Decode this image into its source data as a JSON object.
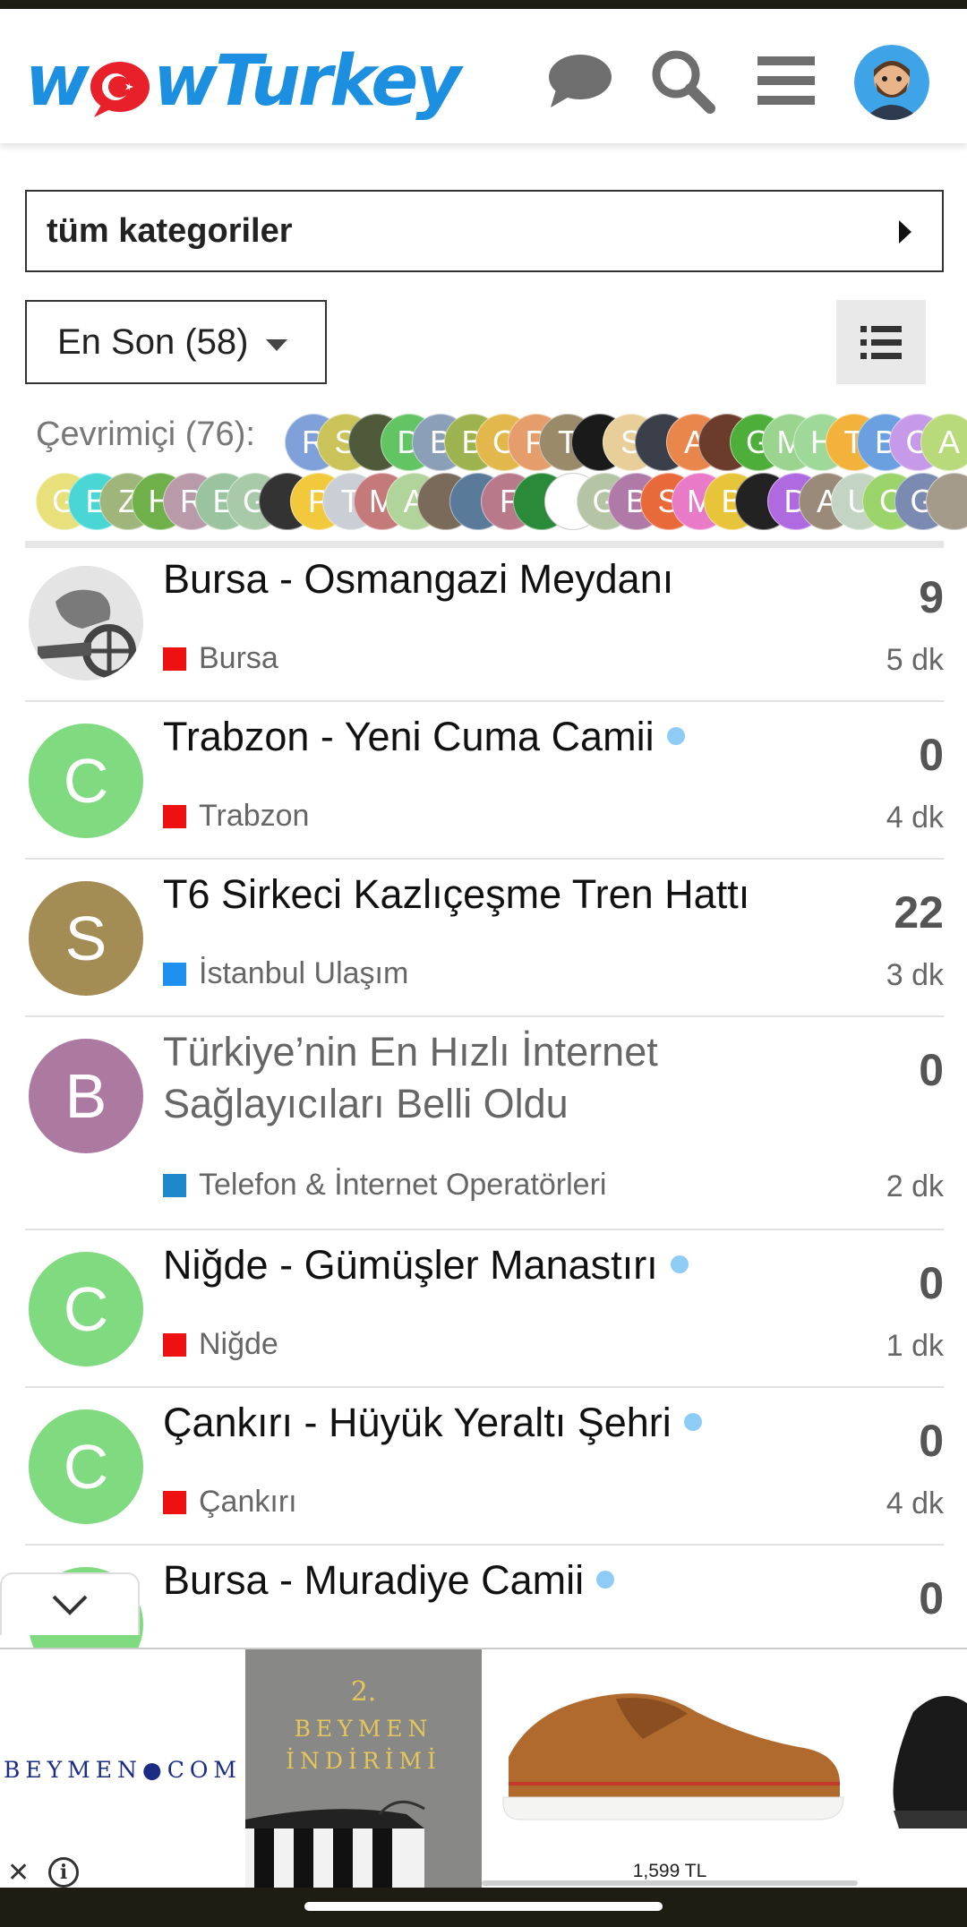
{
  "header": {
    "logo_prefix": "w",
    "logo_suffix": "wTurkey",
    "icons": [
      "chat-bubble-icon",
      "search-icon",
      "hamburger-menu-icon",
      "user-avatar"
    ]
  },
  "category_filter": {
    "label": "tüm kategoriler"
  },
  "sort_filter": {
    "label": "En Son (58)"
  },
  "online": {
    "label": "Çevrimiçi (76):",
    "row1": [
      {
        "l": "R",
        "c": "#7fa0d9"
      },
      {
        "l": "S",
        "c": "#c9c35a"
      },
      {
        "l": "",
        "c": "#4f5a3a"
      },
      {
        "l": "D",
        "c": "#62c462"
      },
      {
        "l": "B",
        "c": "#8c9fb8"
      },
      {
        "l": "B",
        "c": "#9db34f"
      },
      {
        "l": "C",
        "c": "#e2b84d"
      },
      {
        "l": "P",
        "c": "#e59e6b"
      },
      {
        "l": "T",
        "c": "#9a8a6a"
      },
      {
        "l": "",
        "c": "#1a1a1a"
      },
      {
        "l": "S",
        "c": "#e8cf9a"
      },
      {
        "l": "",
        "c": "#3a3f4a"
      },
      {
        "l": "A",
        "c": "#e8864c"
      },
      {
        "l": "",
        "c": "#6b3b2b"
      },
      {
        "l": "G",
        "c": "#4eae3a"
      },
      {
        "l": "M",
        "c": "#9ad48f"
      },
      {
        "l": "H",
        "c": "#9fd99a"
      },
      {
        "l": "T",
        "c": "#f2b23c"
      },
      {
        "l": "B",
        "c": "#6aa0e0"
      },
      {
        "l": "C",
        "c": "#c69ae8"
      },
      {
        "l": "A",
        "c": "#b8da7a"
      }
    ],
    "row2": [
      {
        "l": "G",
        "c": "#e8e07a"
      },
      {
        "l": "E",
        "c": "#4bd6d6"
      },
      {
        "l": "Z",
        "c": "#9fb57a"
      },
      {
        "l": "H",
        "c": "#6fb04a"
      },
      {
        "l": "R",
        "c": "#b89aa8"
      },
      {
        "l": "E",
        "c": "#9ac4a0"
      },
      {
        "l": "G",
        "c": "#a8caa8"
      },
      {
        "l": "",
        "c": "#333333"
      },
      {
        "l": "P",
        "c": "#f2c93c"
      },
      {
        "l": "T",
        "c": "#c9cfd4"
      },
      {
        "l": "M",
        "c": "#c57a7a"
      },
      {
        "l": "A",
        "c": "#b0d49a"
      },
      {
        "l": "",
        "c": "#7a6a5a"
      },
      {
        "l": "",
        "c": "#5a7a9a"
      },
      {
        "l": "F",
        "c": "#b87a8a"
      },
      {
        "l": "",
        "c": "#2a8a3a"
      },
      {
        "l": "",
        "c": "#ffffff"
      },
      {
        "l": "G",
        "c": "#b4c4a4"
      },
      {
        "l": "B",
        "c": "#b07aa8"
      },
      {
        "l": "S",
        "c": "#e86a3a"
      },
      {
        "l": "M",
        "c": "#e87ac8"
      },
      {
        "l": "B",
        "c": "#e8c43a"
      },
      {
        "l": "",
        "c": "#222222"
      },
      {
        "l": "D",
        "c": "#b06ae0"
      },
      {
        "l": "A",
        "c": "#9a8a7a"
      },
      {
        "l": "U",
        "c": "#c4d4c4"
      },
      {
        "l": "C",
        "c": "#9ad46a"
      },
      {
        "l": "G",
        "c": "#7a8ab0"
      },
      {
        "l": "",
        "c": "#a49a8a"
      }
    ]
  },
  "topics": [
    {
      "title": "Bursa - Osmangazi Meydanı",
      "category": "Bursa",
      "cat_color": "#ee1111",
      "count": "9",
      "age": "5 dk",
      "avatar_letter": "",
      "avatar_color": "#d8d8d8",
      "unread": false,
      "read": false
    },
    {
      "title": "Trabzon - Yeni Cuma Camii",
      "category": "Trabzon",
      "cat_color": "#ee1111",
      "count": "0",
      "age": "4 dk",
      "avatar_letter": "C",
      "avatar_color": "#7fda80",
      "unread": true,
      "read": false
    },
    {
      "title": "T6 Sirkeci Kazlıçeşme Tren Hattı",
      "category": "İstanbul Ulaşım",
      "cat_color": "#1e90ee",
      "count": "22",
      "age": "3 dk",
      "avatar_letter": "S",
      "avatar_color": "#a48c55",
      "unread": false,
      "read": false
    },
    {
      "title": "Türkiye’nin En Hızlı İnternet Sağlayıcıları Belli Oldu",
      "category": "Telefon & İnternet Operatörleri",
      "cat_color": "#1e88cc",
      "count": "0",
      "age": "2 dk",
      "avatar_letter": "B",
      "avatar_color": "#ac7aa0",
      "unread": false,
      "read": true
    },
    {
      "title": "Niğde - Gümüşler Manastırı",
      "category": "Niğde",
      "cat_color": "#ee1111",
      "count": "0",
      "age": "1 dk",
      "avatar_letter": "C",
      "avatar_color": "#7fda80",
      "unread": true,
      "read": false
    },
    {
      "title": "Çankırı - Hüyük Yeraltı Şehri",
      "category": "Çankırı",
      "cat_color": "#ee1111",
      "count": "0",
      "age": "4 dk",
      "avatar_letter": "C",
      "avatar_color": "#7fda80",
      "unread": true,
      "read": false
    },
    {
      "title": "Bursa - Muradiye Camii",
      "category": "",
      "cat_color": "#ee1111",
      "count": "0",
      "age": "",
      "avatar_letter": "",
      "avatar_color": "#7fda80",
      "unread": true,
      "read": false
    }
  ],
  "ad": {
    "brand": "BEYMEN●COM",
    "promo_number": "2.",
    "promo_text_line1": "BEYMEN",
    "promo_text_line2": "İNDİRİMİ",
    "price": "1,599 TL",
    "close_glyph": "✕",
    "info_glyph": "i"
  },
  "colors": {
    "accent": "#1d8fe0",
    "logo_red": "#e8202a"
  }
}
